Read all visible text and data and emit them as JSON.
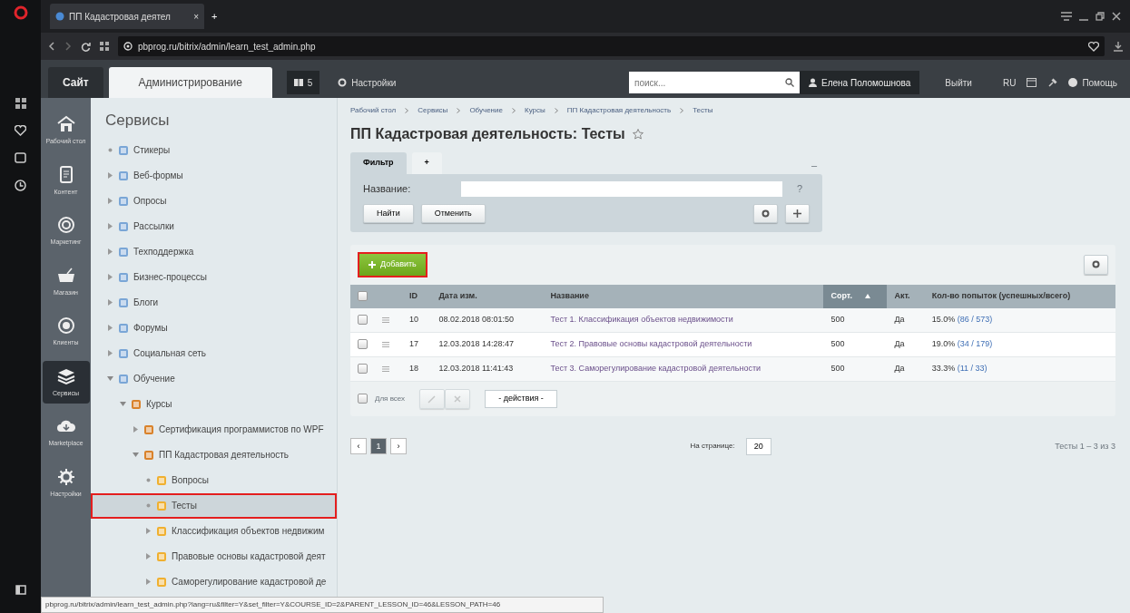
{
  "browser": {
    "tab_title": "ПП Кадастровая деятел",
    "tab_close": "×",
    "new_tab": "+",
    "address": "pbprog.ru/bitrix/admin/learn_test_admin.php"
  },
  "topbar": {
    "tabs": [
      {
        "label": "Сайт",
        "selected": false
      },
      {
        "label": "Администрирование",
        "selected": true
      }
    ],
    "notifications": "5",
    "settings": "Настройки",
    "search": {
      "placeholder": "поиск..."
    },
    "user": "Елена Поломошнова",
    "logout": "Выйти",
    "language": "RU",
    "help": "Помощь"
  },
  "menu": [
    {
      "label": "Рабочий стол",
      "selected": false
    },
    {
      "label": "Контент",
      "selected": false
    },
    {
      "label": "Маркетинг",
      "selected": false
    },
    {
      "label": "Магазин",
      "selected": false
    },
    {
      "label": "Клиенты",
      "selected": false
    },
    {
      "label": "Сервисы",
      "selected": true
    },
    {
      "label": "Marketplace",
      "selected": false
    },
    {
      "label": "Настройки",
      "selected": false
    }
  ],
  "tree": {
    "title": "Сервисы",
    "items": [
      {
        "label": "Стикеры",
        "kind": "leaf",
        "selected": false,
        "outlined": false
      },
      {
        "label": "Веб-формы",
        "kind": "folder",
        "expanded": false,
        "selected": false,
        "outlined": false
      },
      {
        "label": "Опросы",
        "kind": "folder",
        "expanded": false,
        "selected": false,
        "outlined": false
      },
      {
        "label": "Рассылки",
        "kind": "folder",
        "expanded": false,
        "selected": false,
        "outlined": false
      },
      {
        "label": "Техподдержка",
        "kind": "folder",
        "expanded": false,
        "selected": false,
        "outlined": false
      },
      {
        "label": "Бизнес-процессы",
        "kind": "folder",
        "expanded": false,
        "selected": false,
        "outlined": false
      },
      {
        "label": "Блоги",
        "kind": "folder",
        "expanded": false,
        "selected": false,
        "outlined": false
      },
      {
        "label": "Форумы",
        "kind": "folder",
        "expanded": false,
        "selected": false,
        "outlined": false
      },
      {
        "label": "Социальная сеть",
        "kind": "folder",
        "expanded": false,
        "selected": false,
        "outlined": false
      },
      {
        "label": "Обучение",
        "kind": "folder",
        "expanded": true,
        "selected": false,
        "outlined": false,
        "children": [
          {
            "label": "Курсы",
            "kind": "folder",
            "expanded": true,
            "selected": false,
            "outlined": false,
            "children": [
              {
                "label": "Сертификация программистов по WPF",
                "kind": "folder",
                "expanded": false,
                "selected": false,
                "outlined": false
              },
              {
                "label": "ПП Кадастровая деятельность",
                "kind": "folder",
                "expanded": true,
                "selected": false,
                "outlined": false,
                "children": [
                  {
                    "label": "Вопросы",
                    "kind": "leaf",
                    "selected": false,
                    "outlined": false
                  },
                  {
                    "label": "Тесты",
                    "kind": "leaf",
                    "selected": true,
                    "outlined": true
                  },
                  {
                    "label": "Классификация объектов недвижим",
                    "kind": "folder",
                    "expanded": false,
                    "selected": false,
                    "outlined": false
                  },
                  {
                    "label": "Правовые основы кадастровой деят",
                    "kind": "folder",
                    "expanded": false,
                    "selected": false,
                    "outlined": false
                  },
                  {
                    "label": "Саморегулирование кадастровой де",
                    "kind": "folder",
                    "expanded": false,
                    "selected": false,
                    "outlined": false
                  }
                ]
              }
            ]
          }
        ]
      }
    ]
  },
  "breadcrumbs": [
    "Рабочий стол",
    "Сервисы",
    "Обучение",
    "Курсы",
    "ПП Кадастровая деятельность",
    "Тесты"
  ],
  "page_title": "ПП Кадастровая деятельность: Тесты",
  "filter": {
    "tabs": [
      {
        "label": "Фильтр",
        "selected": true
      },
      {
        "label": "+",
        "selected": false
      }
    ],
    "collapse": "–",
    "field_label": "Название:",
    "field_help": "?",
    "buttons": [
      "Найти",
      "Отменить"
    ]
  },
  "list": {
    "add_button": {
      "label": "Добавить",
      "outlined": true
    },
    "columns": [
      {
        "kind": "checkbox",
        "checked": false
      },
      {
        "kind": "blank"
      },
      {
        "kind": "text",
        "label": "ID",
        "sorted": false
      },
      {
        "kind": "text",
        "label": "Дата изм.",
        "sorted": false
      },
      {
        "kind": "text",
        "label": "Название",
        "sorted": false
      },
      {
        "kind": "text",
        "label": "Сорт.",
        "sorted": true
      },
      {
        "kind": "text",
        "label": "Акт.",
        "sorted": false
      },
      {
        "kind": "text",
        "label": "Кол-во попыток (успешных/всего)",
        "sorted": false
      }
    ],
    "rows": [
      {
        "checked": false,
        "id": "10",
        "date": "08.02.2018 08:01:50",
        "name": "Тест 1. Классификация объектов недвижимости",
        "sort": "500",
        "active": "Да",
        "percent": "15.0%",
        "attempts": "(86 / 573)"
      },
      {
        "checked": false,
        "id": "17",
        "date": "12.03.2018 14:28:47",
        "name": "Тест 2. Правовые основы кадастровой деятельности",
        "sort": "500",
        "active": "Да",
        "percent": "19.0%",
        "attempts": "(34 / 179)"
      },
      {
        "checked": false,
        "id": "18",
        "date": "12.03.2018 11:41:43",
        "name": "Тест 3. Саморегулирование кадастровой деятельности",
        "sort": "500",
        "active": "Да",
        "percent": "33.3%",
        "attempts": "(11 / 33)"
      }
    ],
    "footer": {
      "all_label": "Для всех",
      "all_checked": false,
      "edit_disabled": true,
      "actions": "- действия -"
    }
  },
  "pagination": {
    "prev": "‹",
    "pages": [
      {
        "label": "1",
        "selected": true
      }
    ],
    "next": "›",
    "per_page_label": "На странице:",
    "per_page": "20",
    "summary": "Тесты 1 – 3 из 3"
  },
  "status_url": "pbprog.ru/bitrix/admin/learn_test_admin.php?lang=ru&filter=Y&set_filter=Y&COURSE_ID=2&PARENT_LESSON_ID=46&LESSON_PATH=46"
}
